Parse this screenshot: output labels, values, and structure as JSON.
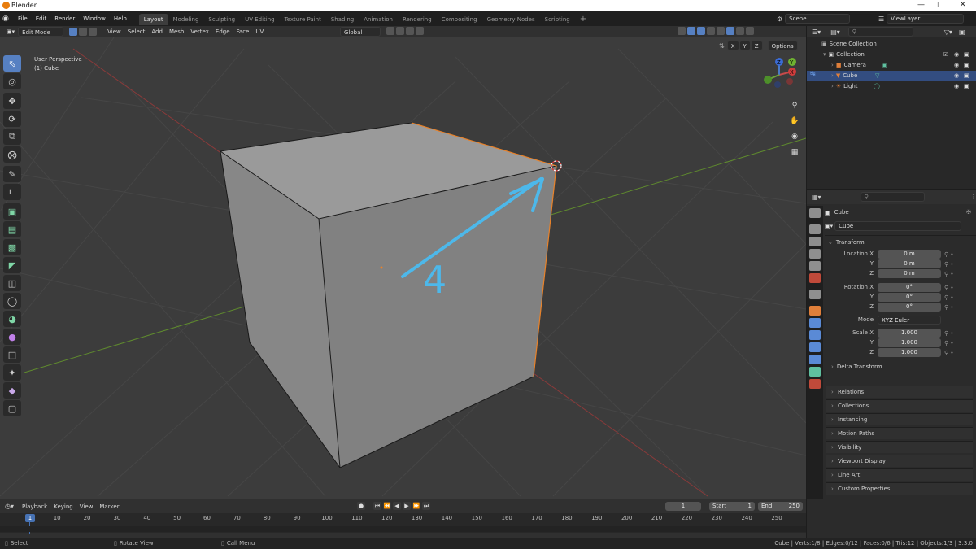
{
  "window": {
    "title": "Blender"
  },
  "menu": [
    "File",
    "Edit",
    "Render",
    "Window",
    "Help"
  ],
  "workspaces": [
    "Layout",
    "Modeling",
    "Sculpting",
    "UV Editing",
    "Texture Paint",
    "Shading",
    "Animation",
    "Rendering",
    "Compositing",
    "Geometry Nodes",
    "Scripting"
  ],
  "active_workspace": "Layout",
  "scene": {
    "name": "Scene",
    "view_layer": "ViewLayer"
  },
  "viewport_header": {
    "mode": "Edit Mode",
    "menus": [
      "View",
      "Select",
      "Add",
      "Mesh",
      "Vertex",
      "Edge",
      "Face",
      "UV"
    ],
    "orientation": "Global",
    "options": "Options",
    "axis_toggles": [
      "X",
      "Y",
      "Z"
    ]
  },
  "viewport": {
    "view_name": "User Perspective",
    "object_label": "(1) Cube",
    "annotation": "4",
    "gizmo_axes": [
      "X",
      "Y",
      "Z"
    ]
  },
  "toolbar_icons": [
    "select-box-icon",
    "cursor-icon",
    "move-icon",
    "rotate-icon",
    "scale-icon",
    "transform-icon",
    "annotate-icon",
    "measure-icon",
    "add-cube-icon",
    "extrude-icon",
    "inset-icon",
    "bevel-icon",
    "loop-cut-icon",
    "knife-icon",
    "poly-build-icon",
    "spin-icon",
    "smooth-icon",
    "edge-slide-icon",
    "shrink-fatten-icon",
    "shear-icon",
    "rip-region-icon"
  ],
  "outliner": {
    "root": "Scene Collection",
    "items": [
      {
        "name": "Collection",
        "indent": 1
      },
      {
        "name": "Camera",
        "indent": 2
      },
      {
        "name": "Cube",
        "indent": 2,
        "selected": true
      },
      {
        "name": "Light",
        "indent": 2
      }
    ]
  },
  "properties": {
    "object_name": "Cube",
    "datablock": "Cube",
    "transform_title": "Transform",
    "location_label": "Location X",
    "rotation_label": "Rotation X",
    "scale_label": "Scale X",
    "y": "Y",
    "z": "Z",
    "location": [
      "0 m",
      "0 m",
      "0 m"
    ],
    "rotation": [
      "0°",
      "0°",
      "0°"
    ],
    "mode_label": "Mode",
    "mode_value": "XYZ Euler",
    "scale": [
      "1.000",
      "1.000",
      "1.000"
    ],
    "delta": "Delta Transform",
    "panels": [
      "Relations",
      "Collections",
      "Instancing",
      "Motion Paths",
      "Visibility",
      "Viewport Display",
      "Line Art",
      "Custom Properties"
    ]
  },
  "timeline": {
    "menus": [
      "Playback",
      "Keying",
      "View",
      "Marker"
    ],
    "current_frame": "1",
    "start_label": "Start",
    "start": "1",
    "end_label": "End",
    "end": "250",
    "ticks": [
      "10",
      "20",
      "30",
      "40",
      "50",
      "60",
      "70",
      "80",
      "90",
      "100",
      "110",
      "120",
      "130",
      "140",
      "150",
      "160",
      "170",
      "180",
      "190",
      "200",
      "210",
      "220",
      "230",
      "240",
      "250"
    ],
    "playhead": "1"
  },
  "statusbar": {
    "select": "Select",
    "rotate": "Rotate View",
    "call_menu": "Call Menu",
    "stats": "Cube | Verts:1/8 | Edges:0/12 | Faces:0/6 | Tris:12 | Objects:1/3 | 3.3.0"
  },
  "colors": {
    "accent": "#5680c2",
    "selection": "#334d80",
    "annotation": "#4db8ea",
    "edit_edge": "#e8822a"
  }
}
